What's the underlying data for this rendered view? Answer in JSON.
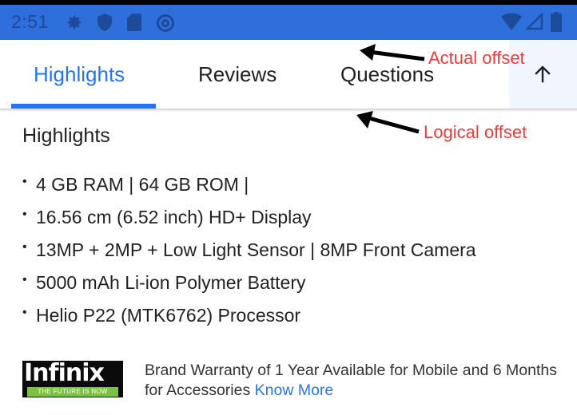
{
  "status_bar": {
    "time": "2:51",
    "background": "#2f6fdc",
    "left_icons": [
      "settings-icon",
      "shield-icon",
      "sd-card-icon",
      "at-sign-icon"
    ],
    "right_icons": [
      "wifi-icon",
      "signal-icon",
      "battery-icon"
    ]
  },
  "tabs": [
    {
      "label": "Highlights",
      "active": true
    },
    {
      "label": "Reviews",
      "active": false
    },
    {
      "label": "Questions",
      "active": false
    }
  ],
  "scroll_top_button": {
    "icon": "arrow-up-icon"
  },
  "annotations": {
    "actual": "Actual offset",
    "logical": "Logical offset"
  },
  "section": {
    "title": "Highlights",
    "bullet": "•",
    "items": [
      "4 GB RAM | 64 GB ROM |",
      "16.56 cm (6.52 inch) HD+ Display",
      "13MP + 2MP + Low Light Sensor | 8MP Front Camera",
      "5000 mAh Li-ion Polymer Battery",
      "Helio P22 (MTK6762) Processor"
    ]
  },
  "brand": {
    "name": "Infinix",
    "tagline": "THE FUTURE IS NOW",
    "warranty_text": "Brand Warranty of 1 Year Available for Mobile and 6 Months for Accessories",
    "know_more": "Know More"
  },
  "colors": {
    "accent": "#2874f0",
    "annotation": "#ef3b3b",
    "status_bar": "#2f6fdc"
  }
}
